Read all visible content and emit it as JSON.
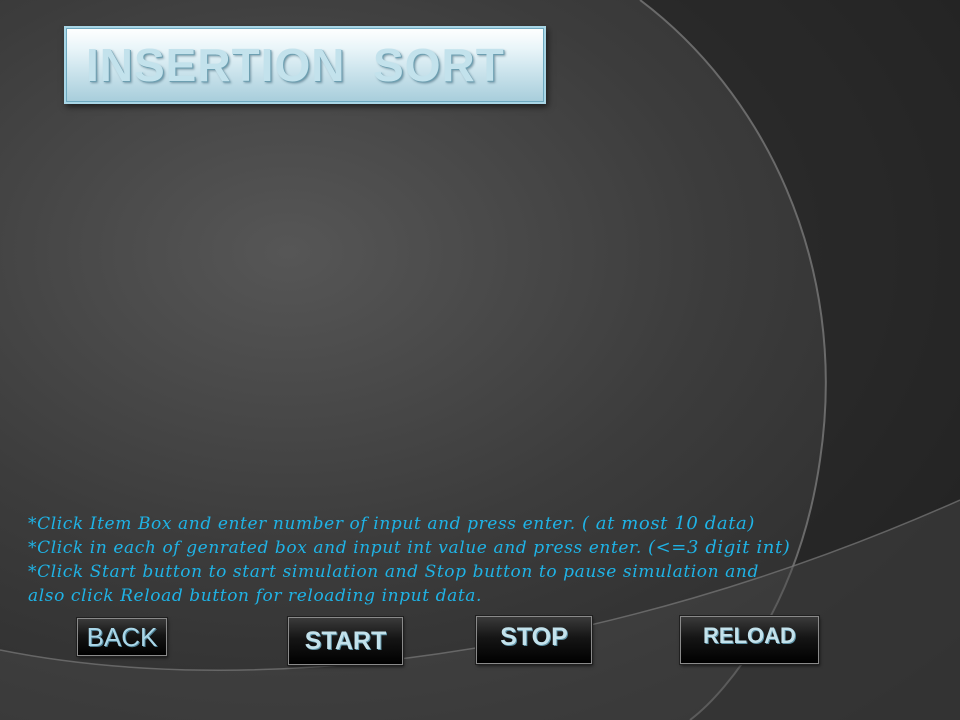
{
  "title": {
    "text": "INSERTION  SORT"
  },
  "instructions": {
    "line1": "*Click Item Box and enter number of input and press enter.",
    "line1_note": "( at most 10 data)",
    "line2": "*Click in each of genrated box and input int value and press enter.",
    "line2_note": "(<=3 digit int)",
    "line3": "*Click Start button to start simulation and Stop button to pause simulation and",
    "line4": "also click Reload button for reloading input data."
  },
  "buttons": {
    "back": "BACK",
    "start": "START",
    "stop": "STOP",
    "reload": "RELOAD"
  },
  "colors": {
    "instruction_text": "#1fb3e6",
    "title_text": "#c3e2ec",
    "background": "#3c3c3c"
  }
}
